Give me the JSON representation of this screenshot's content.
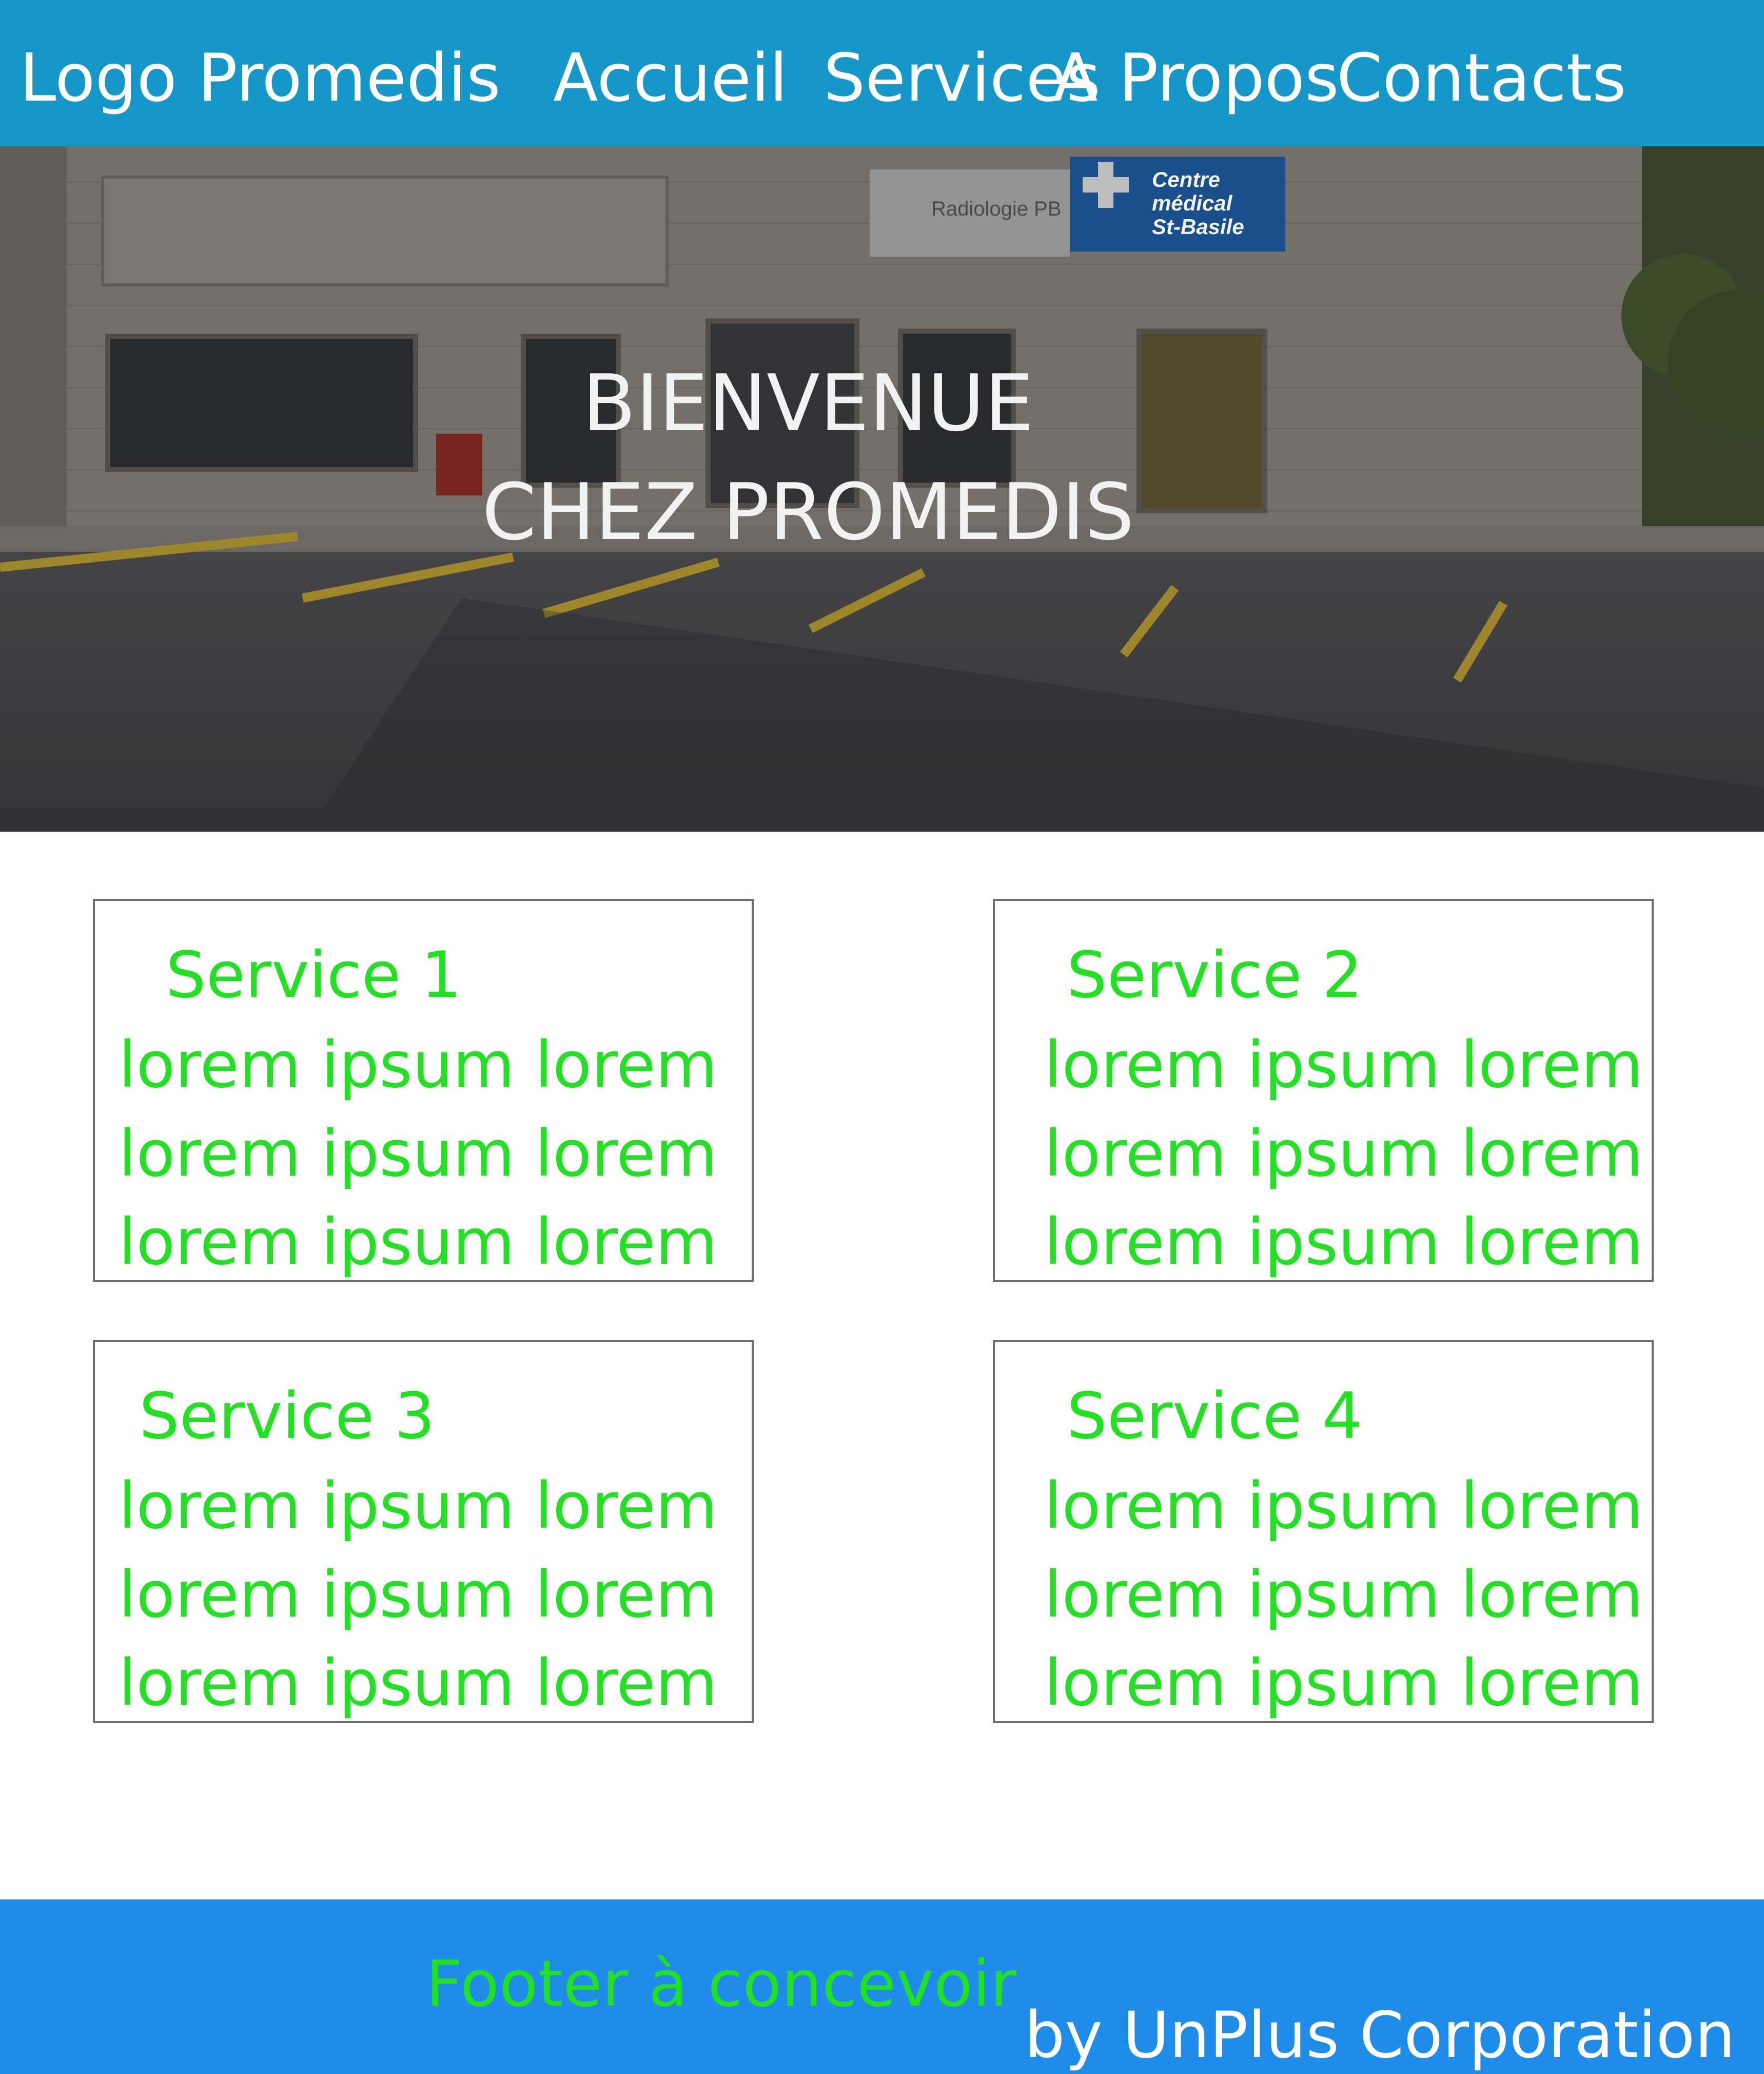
{
  "header": {
    "logo": "Logo Promedis",
    "nav": {
      "accueil": "Accueil",
      "services": "Services",
      "apropos": "A Propos",
      "contacts": "Contacts"
    }
  },
  "hero": {
    "title_line1": "BIENVENUE",
    "title_line2": "CHEZ PROMEDIS",
    "sign_radiologie": "Radiologie PB",
    "sign_centre": [
      "Centre",
      "médical",
      "St-Basile"
    ]
  },
  "services": [
    {
      "title": "Service 1",
      "lines": [
        "lorem ipsum lorem",
        "lorem ipsum lorem",
        "lorem ipsum lorem"
      ]
    },
    {
      "title": "Service 2",
      "lines": [
        "lorem ipsum lorem",
        "lorem ipsum lorem",
        "lorem ipsum lorem"
      ]
    },
    {
      "title": "Service 3",
      "lines": [
        "lorem ipsum lorem",
        "lorem ipsum lorem",
        "lorem ipsum lorem"
      ]
    },
    {
      "title": "Service 4",
      "lines": [
        "lorem ipsum lorem",
        "lorem ipsum lorem",
        "lorem ipsum lorem"
      ]
    }
  ],
  "footer": {
    "text": "Footer à concevoir",
    "credit": "by UnPlus Corporation"
  },
  "colors": {
    "header_bg": "#1597c9",
    "footer_bg": "#1e8ce8",
    "service_text": "#22e022",
    "card_border": "#6e6e6e"
  }
}
